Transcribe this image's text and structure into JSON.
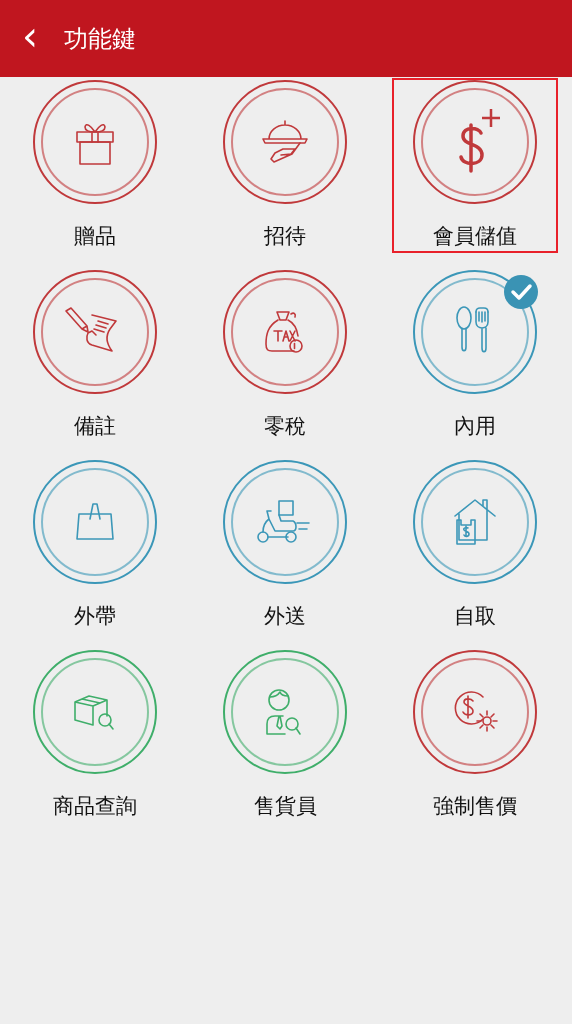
{
  "header": {
    "back": "‹",
    "title": "功能鍵"
  },
  "items": [
    {
      "label": "贈品",
      "color": "#c0393b",
      "checked": false,
      "selected": false
    },
    {
      "label": "招待",
      "color": "#c0393b",
      "checked": false,
      "selected": false
    },
    {
      "label": "會員儲值",
      "color": "#c0393b",
      "checked": false,
      "selected": true
    },
    {
      "label": "備註",
      "color": "#c0393b",
      "checked": false,
      "selected": false
    },
    {
      "label": "零稅",
      "color": "#c0393b",
      "checked": false,
      "selected": false
    },
    {
      "label": "內用",
      "color": "#3b97b8",
      "checked": true,
      "selected": false
    },
    {
      "label": "外帶",
      "color": "#3b97b8",
      "checked": false,
      "selected": false
    },
    {
      "label": "外送",
      "color": "#3b97b8",
      "checked": false,
      "selected": false
    },
    {
      "label": "自取",
      "color": "#3b97b8",
      "checked": false,
      "selected": false
    },
    {
      "label": "商品查詢",
      "color": "#3fae6a",
      "checked": false,
      "selected": false
    },
    {
      "label": "售貨員",
      "color": "#3fae6a",
      "checked": false,
      "selected": false
    },
    {
      "label": "強制售價",
      "color": "#c0393b",
      "checked": false,
      "selected": false
    }
  ]
}
